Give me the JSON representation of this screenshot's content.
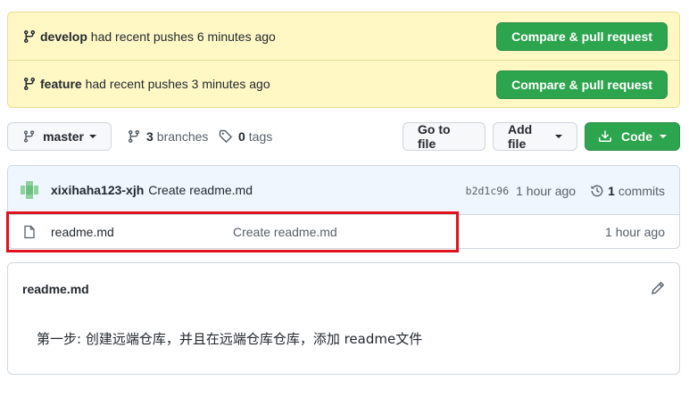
{
  "flash": [
    {
      "branch": "develop",
      "text": "had recent pushes 6 minutes ago",
      "button": "Compare & pull request"
    },
    {
      "branch": "feature",
      "text": "had recent pushes 3 minutes ago",
      "button": "Compare & pull request"
    }
  ],
  "toolbar": {
    "branch_select": "master",
    "branches_count": "3",
    "branches_label": "branches",
    "tags_count": "0",
    "tags_label": "tags",
    "go_to_file": "Go to file",
    "add_file": "Add file",
    "code": "Code"
  },
  "commit": {
    "author": "xixihaha123-xjh",
    "message": "Create readme.md",
    "sha": "b2d1c96",
    "age": "1 hour ago",
    "commits_count": "1",
    "commits_label": "commits"
  },
  "files": [
    {
      "name": "readme.md",
      "message": "Create readme.md",
      "age": "1 hour ago",
      "icon": "file-icon"
    }
  ],
  "readme": {
    "title": "readme.md",
    "content": "第一步: 创建远端仓库，并且在远端仓库仓库，添加 readme文件"
  },
  "colors": {
    "flash_bg": "#fff8c5",
    "green": "#2da44e",
    "highlight": "#e0101c"
  }
}
